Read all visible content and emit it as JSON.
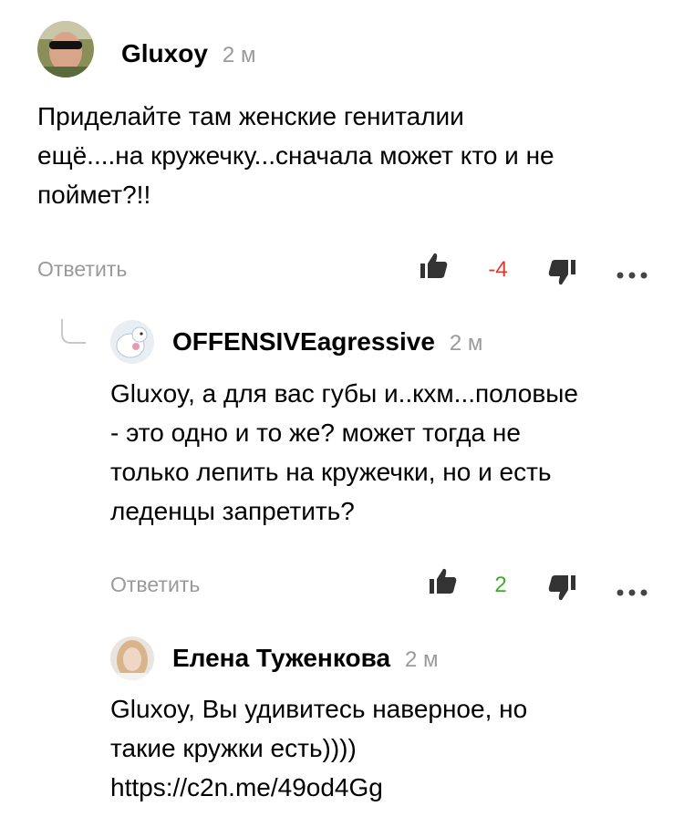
{
  "comments": [
    {
      "author": "Gluxoy",
      "time": "2 м",
      "text_lines": [
        "Приделайте там женские гениталии",
        "ещё....на кружечку...сначала может кто и не",
        "поймет?!!"
      ],
      "reply_label": "Ответить",
      "score": "-4",
      "score_color": "#e03a2f"
    },
    {
      "author": "OFFENSIVEagressive",
      "time": "2 м",
      "text_lines": [
        "Gluxoy, а для вас губы и..кхм...половые",
        "- это одно и то же? может тогда не",
        "только лепить на кружечки, но и есть",
        "леденцы запретить?"
      ],
      "reply_label": "Ответить",
      "score": "2",
      "score_color": "#3fae2a"
    },
    {
      "author": "Елена Туженкова",
      "time": "2 м",
      "text_lines": [
        "Gluxoy, Вы удивитесь наверное, но",
        "такие кружки есть))))",
        "https://c2n.me/49od4Gg"
      ]
    }
  ],
  "icons": {
    "like": "thumbs-up-icon",
    "dislike": "thumbs-down-icon",
    "more": "more-dots-icon"
  }
}
